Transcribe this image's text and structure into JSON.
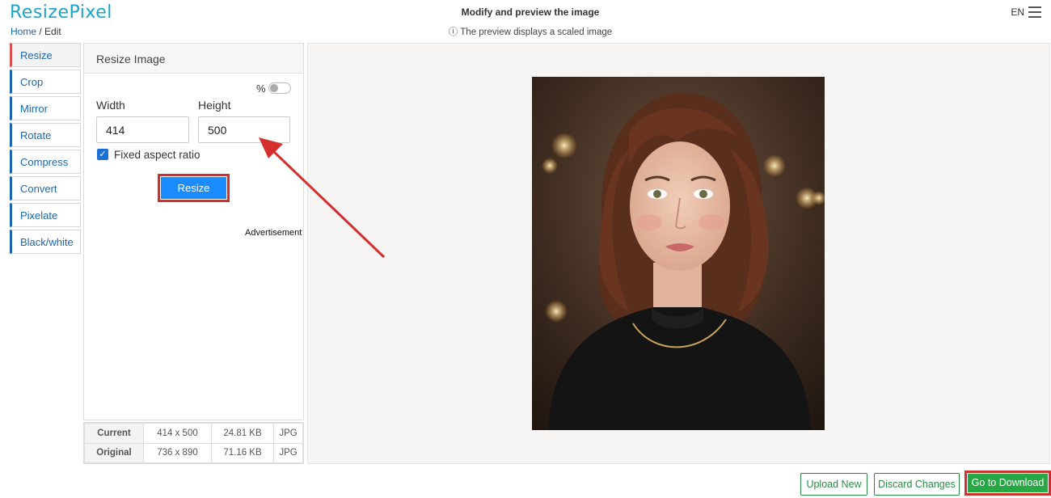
{
  "header": {
    "logo": "ResizePixel",
    "breadcrumb_home": "Home",
    "breadcrumb_sep": " / ",
    "breadcrumb_current": "Edit",
    "title": "Modify and preview the image",
    "subtitle": "ⓘ The preview displays a scaled image",
    "language": "EN"
  },
  "sidebar": {
    "items": [
      {
        "label": "Resize",
        "active": true
      },
      {
        "label": "Crop"
      },
      {
        "label": "Mirror"
      },
      {
        "label": "Rotate"
      },
      {
        "label": "Compress"
      },
      {
        "label": "Convert"
      },
      {
        "label": "Pixelate"
      },
      {
        "label": "Black/white"
      }
    ]
  },
  "panel": {
    "title": "Resize Image",
    "percent_label": "%",
    "width_label": "Width",
    "height_label": "Height",
    "width_value": "414",
    "height_value": "500",
    "aspect_label": "Fixed aspect ratio",
    "resize_button": "Resize",
    "advertisement": "Advertisement"
  },
  "info": {
    "rows": [
      {
        "label": "Current",
        "dims": "414 x 500",
        "size": "24.81 KB",
        "format": "JPG"
      },
      {
        "label": "Original",
        "dims": "736 x 890",
        "size": "71.16 KB",
        "format": "JPG"
      }
    ]
  },
  "actions": {
    "upload_new": "Upload New",
    "discard": "Discard Changes",
    "download": "Go to Download"
  },
  "colors": {
    "accent": "#1a8cff",
    "logo": "#17a6c9",
    "success": "#28a745",
    "highlight": "#d32f2f"
  }
}
